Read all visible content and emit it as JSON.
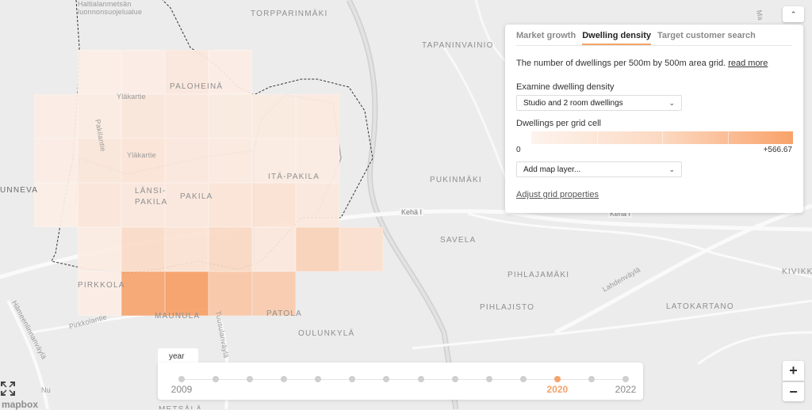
{
  "map": {
    "labels": [
      {
        "text": "Haltialanmetsän",
        "cls": "small"
      },
      {
        "text": "luonnonsuojelualue",
        "cls": "small"
      },
      {
        "text": "TORPPARINMÄKI",
        "cls": ""
      },
      {
        "text": "TAPANINVAINIO",
        "cls": ""
      },
      {
        "text": "PALOHEINÄ",
        "cls": ""
      },
      {
        "text": "Yläkartie",
        "cls": "small"
      },
      {
        "text": "Pakilantie",
        "cls": "small"
      },
      {
        "text": "Yläkartie",
        "cls": "small"
      },
      {
        "text": "LÄNSI-",
        "cls": ""
      },
      {
        "text": "PAKILA",
        "cls": ""
      },
      {
        "text": "PAKILA",
        "cls": ""
      },
      {
        "text": "ITÄ-PAKILA",
        "cls": ""
      },
      {
        "text": "UNNEVA",
        "cls": "dark"
      },
      {
        "text": "PUKINMÄKI",
        "cls": ""
      },
      {
        "text": "SAVELA",
        "cls": ""
      },
      {
        "text": "Kehä I",
        "cls": "small"
      },
      {
        "text": "Kehä I",
        "cls": "small"
      },
      {
        "text": "PIRKKOLA",
        "cls": ""
      },
      {
        "text": "MAUNULA",
        "cls": ""
      },
      {
        "text": "PATOLA",
        "cls": ""
      },
      {
        "text": "OULUNKYLÄ",
        "cls": ""
      },
      {
        "text": "PIHLAJAMÄKI",
        "cls": ""
      },
      {
        "text": "PIHLAJISTO",
        "cls": ""
      },
      {
        "text": "LATOKARTANO",
        "cls": ""
      },
      {
        "text": "KIVIKK",
        "cls": ""
      },
      {
        "text": "Lahdenväylä",
        "cls": "small"
      },
      {
        "text": "Pirkkolantie",
        "cls": "small"
      },
      {
        "text": "Hämeenlinnanväylä",
        "cls": "small"
      },
      {
        "text": "Tuusulanväylä",
        "cls": "small"
      },
      {
        "text": "Ma",
        "cls": "small"
      },
      {
        "text": "Nu",
        "cls": "small"
      },
      {
        "text": "METSÄLÄ",
        "cls": ""
      }
    ],
    "grid_cells": [
      {
        "row": 0,
        "col": 1,
        "value": 8
      },
      {
        "row": 0,
        "col": 2,
        "value": 10
      },
      {
        "row": 0,
        "col": 3,
        "value": 30
      },
      {
        "row": 0,
        "col": 4,
        "value": 10
      },
      {
        "row": 1,
        "col": 0,
        "value": 12
      },
      {
        "row": 1,
        "col": 1,
        "value": 18
      },
      {
        "row": 1,
        "col": 2,
        "value": 35
      },
      {
        "row": 1,
        "col": 3,
        "value": 30
      },
      {
        "row": 1,
        "col": 4,
        "value": 20
      },
      {
        "row": 1,
        "col": 5,
        "value": 20
      },
      {
        "row": 1,
        "col": 6,
        "value": 25
      },
      {
        "row": 2,
        "col": 0,
        "value": 10
      },
      {
        "row": 2,
        "col": 1,
        "value": 35
      },
      {
        "row": 2,
        "col": 2,
        "value": 45
      },
      {
        "row": 2,
        "col": 3,
        "value": 30
      },
      {
        "row": 2,
        "col": 4,
        "value": 25
      },
      {
        "row": 2,
        "col": 5,
        "value": 18
      },
      {
        "row": 2,
        "col": 6,
        "value": 15
      },
      {
        "row": 3,
        "col": 0,
        "value": 8
      },
      {
        "row": 3,
        "col": 1,
        "value": 40
      },
      {
        "row": 3,
        "col": 2,
        "value": 30
      },
      {
        "row": 3,
        "col": 3,
        "value": 30
      },
      {
        "row": 3,
        "col": 4,
        "value": 45
      },
      {
        "row": 3,
        "col": 5,
        "value": 55
      },
      {
        "row": 3,
        "col": 6,
        "value": 30
      },
      {
        "row": 4,
        "col": 1,
        "value": 15
      },
      {
        "row": 4,
        "col": 2,
        "value": 95
      },
      {
        "row": 4,
        "col": 3,
        "value": 55
      },
      {
        "row": 4,
        "col": 4,
        "value": 110
      },
      {
        "row": 4,
        "col": 5,
        "value": 30
      },
      {
        "row": 4,
        "col": 6,
        "value": 150
      },
      {
        "row": 4,
        "col": 7,
        "value": 70
      },
      {
        "row": 5,
        "col": 1,
        "value": 10
      },
      {
        "row": 5,
        "col": 2,
        "value": 520
      },
      {
        "row": 5,
        "col": 3,
        "value": 566.67
      },
      {
        "row": 5,
        "col": 4,
        "value": 230
      },
      {
        "row": 5,
        "col": 5,
        "value": 200
      }
    ],
    "road_labels": [
      "Kehä I",
      "Kehä I"
    ]
  },
  "panel": {
    "tabs": [
      {
        "label": "Market growth",
        "active": false
      },
      {
        "label": "Dwelling density",
        "active": true
      },
      {
        "label": "Target customer search",
        "active": false
      }
    ],
    "description": "The number of dwellings per 500m by 500m area grid.",
    "read_more": "read more",
    "examine_label": "Examine dwelling density",
    "examine_value": "Studio and 2 room dwellings",
    "legend_label": "Dwellings per grid cell",
    "legend_min": "0",
    "legend_max": "+566.67",
    "add_layer_value": "Add map layer...",
    "adjust_link": "Adjust grid properties",
    "collapse_icon": "chevron-up-icon"
  },
  "timeline": {
    "tab_label": "year",
    "dots": 14,
    "active_index": 11,
    "labels": [
      {
        "text": "2009",
        "index": 0,
        "active": false
      },
      {
        "text": "2020",
        "index": 11,
        "active": true
      },
      {
        "text": "2022",
        "index": 13,
        "active": false
      }
    ]
  },
  "controls": {
    "zoom_in": "+",
    "zoom_out": "−",
    "attribution": "mapbox"
  },
  "colors": {
    "accent": "#f4a36b",
    "cell_low": "#fdf3ee",
    "cell_high": "#f7a067"
  }
}
